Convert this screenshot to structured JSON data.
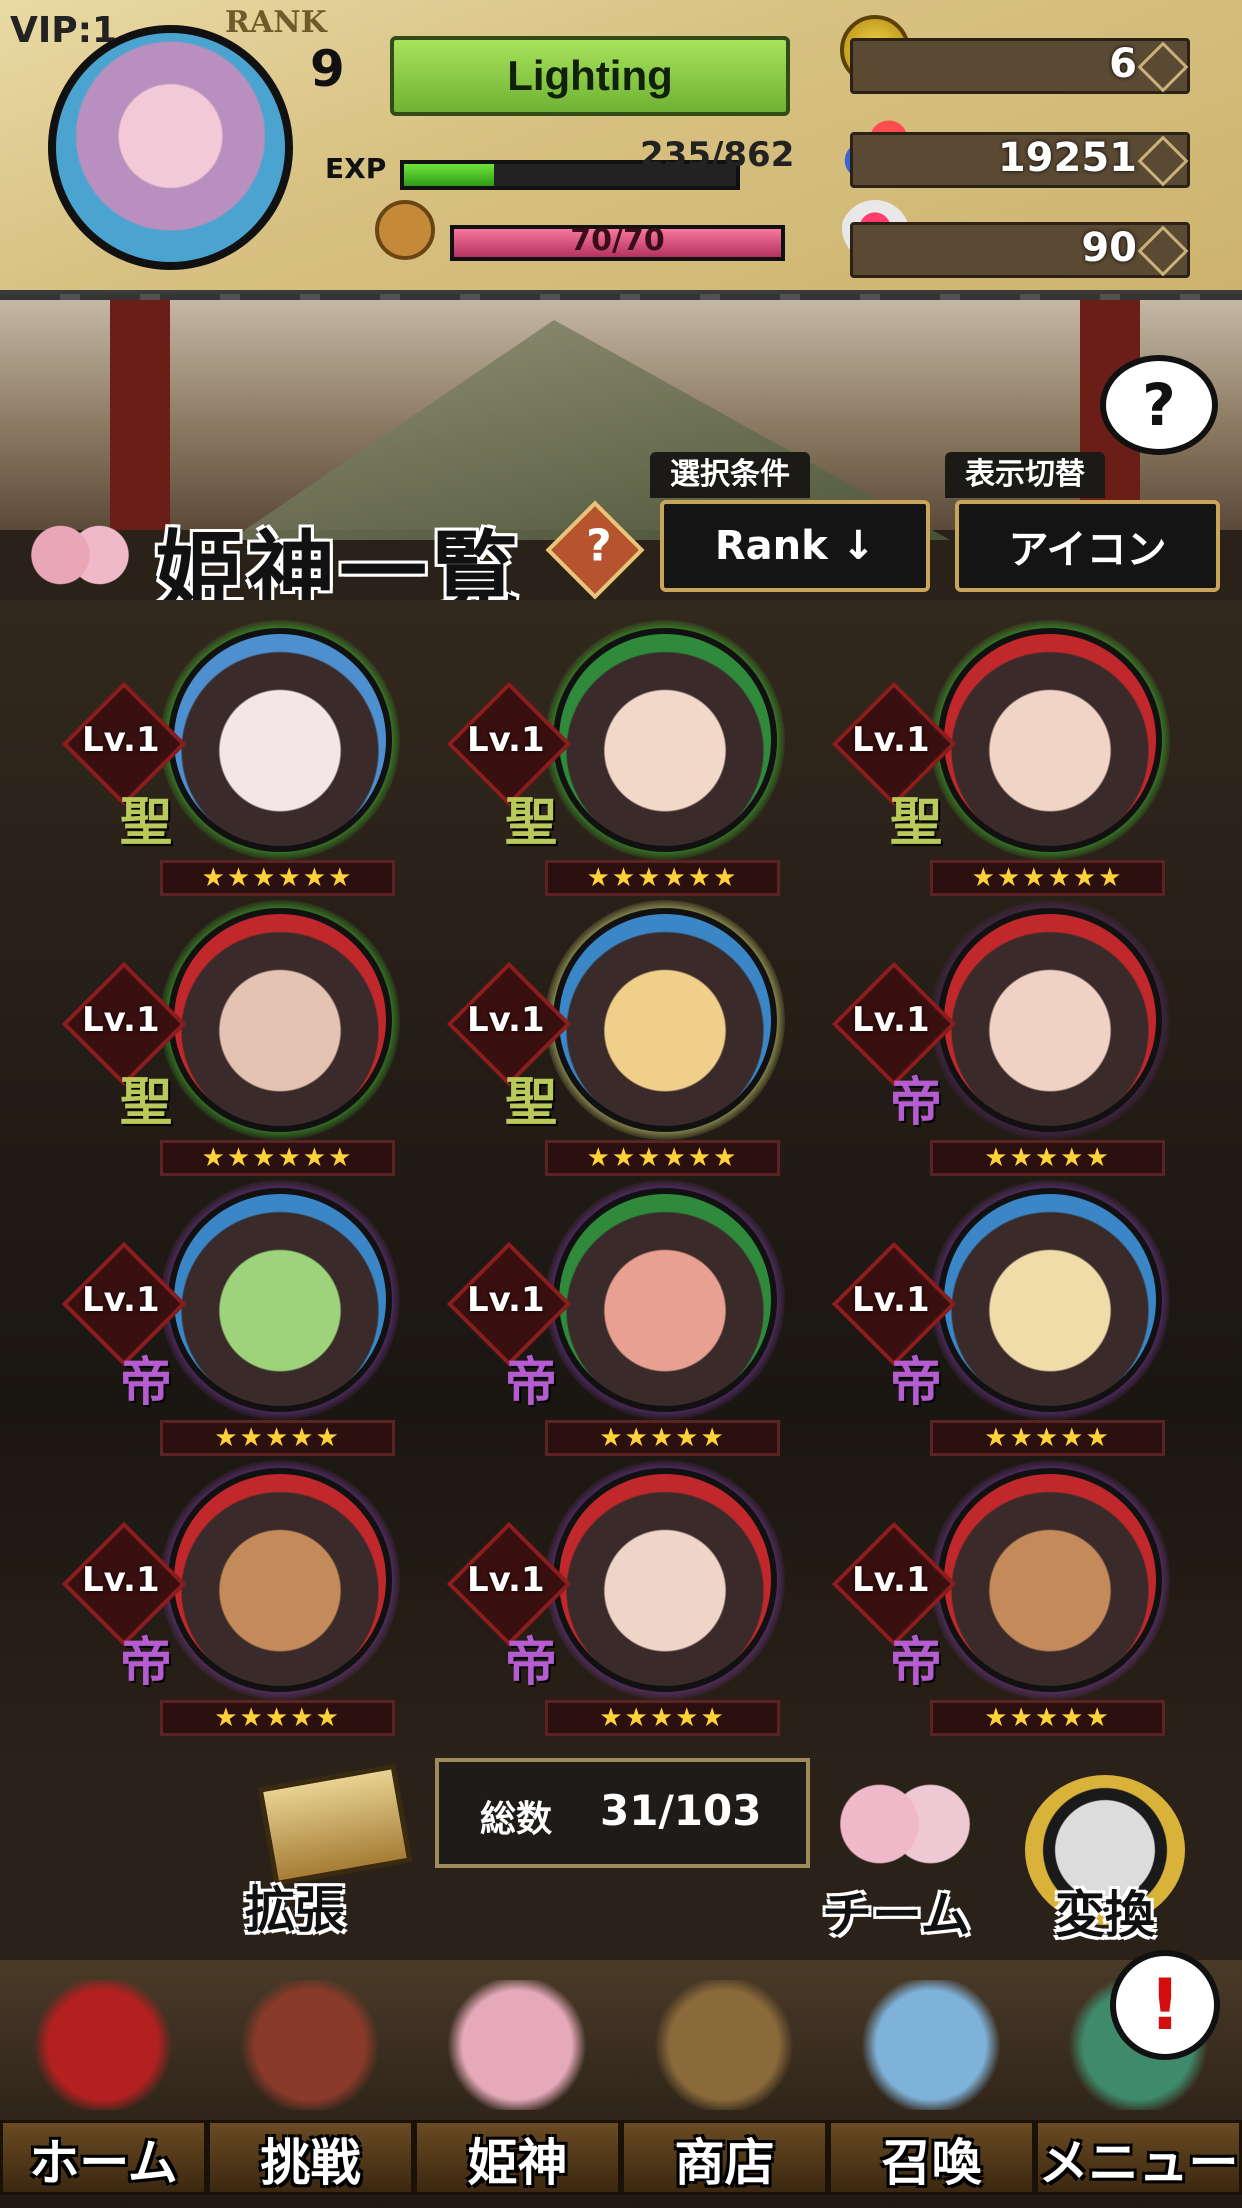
{
  "header": {
    "vip": "VIP:1",
    "rank_label": "RANK",
    "rank": "9",
    "player_name": "Lighting",
    "exp_label": "EXP",
    "exp": "235/862",
    "exp_fraction": 0.27,
    "stamina": "70/70",
    "stamina_fraction": 1.0
  },
  "currencies": [
    {
      "icon": "gold-coin-icon",
      "value": "6"
    },
    {
      "icon": "magatama-gem-icon",
      "value": "19251"
    },
    {
      "icon": "winged-heart-icon",
      "value": "90"
    }
  ],
  "title": {
    "text": "姫神一覧",
    "filter_label": "選択条件",
    "filter_value": "Rank ↓",
    "display_label": "表示切替",
    "display_value": "アイコン"
  },
  "characters": [
    {
      "level": "Lv.1",
      "class": "聖",
      "stars": "★★★★★★",
      "class_color": "#b9c95a",
      "glow": "#3fbf2f",
      "ring": "#4d8fcf",
      "skin": "#f4e6e8"
    },
    {
      "level": "Lv.1",
      "class": "聖",
      "stars": "★★★★★★",
      "class_color": "#b9c95a",
      "glow": "#3fbf2f",
      "ring": "#2f8a3b",
      "skin": "#f1d8c8"
    },
    {
      "level": "Lv.1",
      "class": "聖",
      "stars": "★★★★★★",
      "class_color": "#b9c95a",
      "glow": "#3fbf2f",
      "ring": "#c0282b",
      "skin": "#f0d4c6"
    },
    {
      "level": "Lv.1",
      "class": "聖",
      "stars": "★★★★★★",
      "class_color": "#b9c95a",
      "glow": "#3fbf2f",
      "ring": "#c0282b",
      "skin": "#e5c3b3"
    },
    {
      "level": "Lv.1",
      "class": "聖",
      "stars": "★★★★★★",
      "class_color": "#b9c95a",
      "glow": "#d9e17a",
      "ring": "#3a86c6",
      "skin": "#f0cf8a"
    },
    {
      "level": "Lv.1",
      "class": "帝",
      "stars": "★★★★★",
      "class_color": "#b45cd0",
      "glow": "#5a2a6a",
      "ring": "#c0282b",
      "skin": "#f0d2c4"
    },
    {
      "level": "Lv.1",
      "class": "帝",
      "stars": "★★★★★",
      "class_color": "#b45cd0",
      "glow": "#7a3aa0",
      "ring": "#3a86c6",
      "skin": "#9dd37a"
    },
    {
      "level": "Lv.1",
      "class": "帝",
      "stars": "★★★★★",
      "class_color": "#b45cd0",
      "glow": "#7a3aa0",
      "ring": "#2f8a3b",
      "skin": "#e8a090"
    },
    {
      "level": "Lv.1",
      "class": "帝",
      "stars": "★★★★★",
      "class_color": "#b45cd0",
      "glow": "#7a3aa0",
      "ring": "#3a86c6",
      "skin": "#f0dca8"
    },
    {
      "level": "Lv.1",
      "class": "帝",
      "stars": "★★★★★",
      "class_color": "#b45cd0",
      "glow": "#7a3aa0",
      "ring": "#c0282b",
      "skin": "#c58a5a"
    },
    {
      "level": "Lv.1",
      "class": "帝",
      "stars": "★★★★★",
      "class_color": "#b45cd0",
      "glow": "#7a3aa0",
      "ring": "#c0282b",
      "skin": "#efd4c8"
    },
    {
      "level": "Lv.1",
      "class": "帝",
      "stars": "★★★★★",
      "class_color": "#b45cd0",
      "glow": "#7a3aa0",
      "ring": "#c0282b",
      "skin": "#c58a5a"
    }
  ],
  "footer": {
    "expand_label": "拡張",
    "total_label": "総数",
    "total_value": "31/103",
    "team_label": "チーム",
    "convert_label": "変換"
  },
  "nav": [
    {
      "label": "ホーム",
      "icon": "torii-gate-icon",
      "color": "#b32020"
    },
    {
      "label": "挑戦",
      "icon": "pagoda-icon",
      "color": "#8a3a2a"
    },
    {
      "label": "姫神",
      "icon": "girls-icon",
      "color": "#e5a9b9"
    },
    {
      "label": "商店",
      "icon": "shop-stall-icon",
      "color": "#8a6a3a"
    },
    {
      "label": "召喚",
      "icon": "summon-icon",
      "color": "#7fb2d9"
    },
    {
      "label": "メニュー",
      "icon": "menu-chest-icon",
      "color": "#3f8a6a"
    }
  ],
  "alert": "!"
}
